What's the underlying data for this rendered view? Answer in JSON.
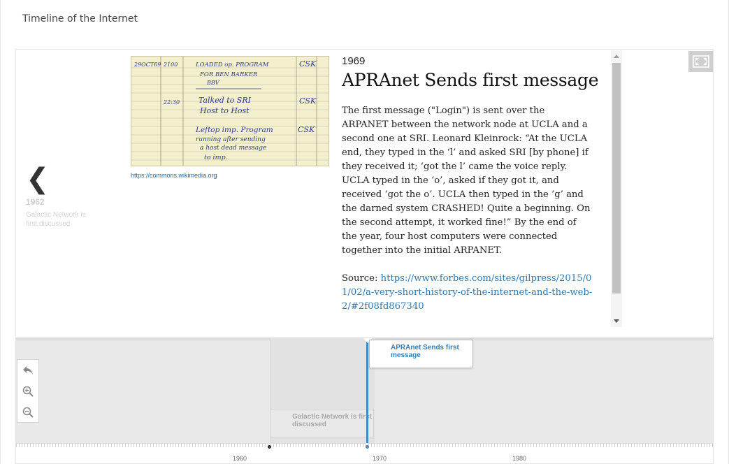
{
  "page": {
    "title": "Timeline of the Internet"
  },
  "slide": {
    "year": "1969",
    "headline": "APRAnet Sends first message",
    "body": "The first message (\"Login\") is sent over the ARPANET between the network node at UCLA and a second one at SRI. Leonard Kleinrock: “At the UCLA end, they typed in the ‘l’ and asked SRI [by phone] if they received it; ‘got the l’ came the voice reply. UCLA typed in the ‘o’, asked if they got it, and received ‘got the o’. UCLA then typed in the ‘g’ and the darned system CRASHED! Quite a beginning. On the second attempt, it worked fine!” By the end of the year, four host computers were connected together into the initial ARPANET.",
    "source_label": "Source:",
    "source_url": "https://www.forbes.com/sites/gilpress/2015/01/02/a-very-short-history-of-the-internet-and-the-web-2/#2f08fd867340",
    "media_credit": "https://commons.wikimedia.org",
    "log_image": {
      "rows": [
        {
          "date": "29OCT69",
          "time": "2100",
          "entry": "LOADED OP. PROGRAM FOR BEN BARKER BBV",
          "initials": "CSK"
        },
        {
          "date": "",
          "time": "22:30",
          "entry": "Talked to SRI Host to Host",
          "initials": "CSK"
        },
        {
          "date": "",
          "time": "",
          "entry": "Leftop imp. Program running after sending a host dead message to imp.",
          "initials": "CSK"
        }
      ]
    }
  },
  "previous": {
    "arrow": "❮",
    "year": "1962",
    "title": "Galactic Network is first discussed"
  },
  "navigation": {
    "active_flag": "APRAnet Sends first message",
    "other_flag": "Galactic Network is first discussed",
    "years": [
      "1960",
      "1970",
      "1980"
    ],
    "tools": [
      "back-icon",
      "zoom-in-icon",
      "zoom-out-icon"
    ]
  },
  "colors": {
    "accent": "#3c8cc8",
    "link": "#2a7ab8"
  }
}
